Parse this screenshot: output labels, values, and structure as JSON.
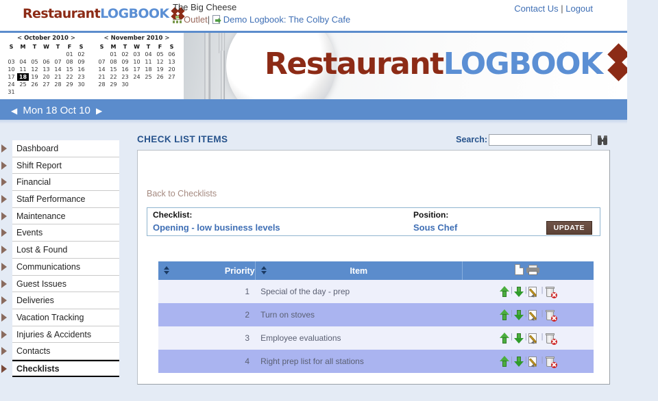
{
  "app": {
    "logo_text_1": "Restaurant",
    "logo_text_2": "LOGBOOK",
    "banner_text_1": "Restaurant",
    "banner_text_2": "LOGBOOK",
    "accent_red": "#8c2b16",
    "accent_blue": "#5b8fd4",
    "header_blue": "#5b8ccc"
  },
  "header": {
    "account_name": "The Big Cheese",
    "outlet_label": "Outlet",
    "separator": "|",
    "logbook_label": "Demo Logbook: The Colby Cafe",
    "contact_us": "Contact Us",
    "logout": "Logout"
  },
  "calendar": {
    "months": [
      {
        "prev_arrow": "<",
        "title": "October 2010",
        "next_arrow": ">",
        "weekdays": [
          "S",
          "M",
          "T",
          "W",
          "T",
          "F",
          "S"
        ],
        "weeks": [
          [
            "",
            "",
            "",
            "",
            "",
            "01",
            "02"
          ],
          [
            "03",
            "04",
            "05",
            "06",
            "07",
            "08",
            "09"
          ],
          [
            "10",
            "11",
            "12",
            "13",
            "14",
            "15",
            "16"
          ],
          [
            "17",
            "18",
            "19",
            "20",
            "21",
            "22",
            "23"
          ],
          [
            "24",
            "25",
            "26",
            "27",
            "28",
            "29",
            "30"
          ],
          [
            "31",
            "",
            "",
            "",
            "",
            "",
            ""
          ]
        ],
        "selected_day": "18"
      },
      {
        "prev_arrow": "<",
        "title": "November 2010",
        "next_arrow": ">",
        "weekdays": [
          "S",
          "M",
          "T",
          "W",
          "T",
          "F",
          "S"
        ],
        "weeks": [
          [
            "",
            "01",
            "02",
            "03",
            "04",
            "05",
            "06"
          ],
          [
            "07",
            "08",
            "09",
            "10",
            "11",
            "12",
            "13"
          ],
          [
            "14",
            "15",
            "16",
            "17",
            "18",
            "19",
            "20"
          ],
          [
            "21",
            "22",
            "23",
            "24",
            "25",
            "26",
            "27"
          ],
          [
            "28",
            "29",
            "30",
            "",
            "",
            "",
            ""
          ]
        ],
        "selected_day": ""
      }
    ]
  },
  "datenav": {
    "prev_arrow": "◀",
    "current_date": "Mon 18 Oct 10",
    "next_arrow": "▶"
  },
  "sidebar": {
    "items": [
      {
        "label": "Dashboard",
        "active": false
      },
      {
        "label": "Shift Report",
        "active": false
      },
      {
        "label": "Financial",
        "active": false
      },
      {
        "label": "Staff Performance",
        "active": false
      },
      {
        "label": "Maintenance",
        "active": false
      },
      {
        "label": "Events",
        "active": false
      },
      {
        "label": "Lost & Found",
        "active": false
      },
      {
        "label": "Communications",
        "active": false
      },
      {
        "label": "Guest Issues",
        "active": false
      },
      {
        "label": "Deliveries",
        "active": false
      },
      {
        "label": "Vacation Tracking",
        "active": false
      },
      {
        "label": "Injuries & Accidents",
        "active": false
      },
      {
        "label": "Contacts",
        "active": false
      },
      {
        "label": "Checklists",
        "active": true
      }
    ]
  },
  "main": {
    "page_title": "CHECK LIST ITEMS",
    "search_label": "Search:",
    "search_value": "",
    "search_placeholder": "",
    "back_link": "Back to Checklists",
    "info": {
      "checklist_label": "Checklist:",
      "checklist_value": "Opening - low business levels",
      "position_label": "Position:",
      "position_value": "Sous Chef",
      "update_button": "UPDATE"
    },
    "table": {
      "columns": [
        "Priority",
        "Item",
        ""
      ],
      "rows": [
        {
          "priority": "1",
          "item": "Special of the day - prep"
        },
        {
          "priority": "2",
          "item": "Turn on stoves"
        },
        {
          "priority": "3",
          "item": "Employee evaluations"
        },
        {
          "priority": "4",
          "item": "Right prep list for all stations"
        }
      ]
    }
  }
}
